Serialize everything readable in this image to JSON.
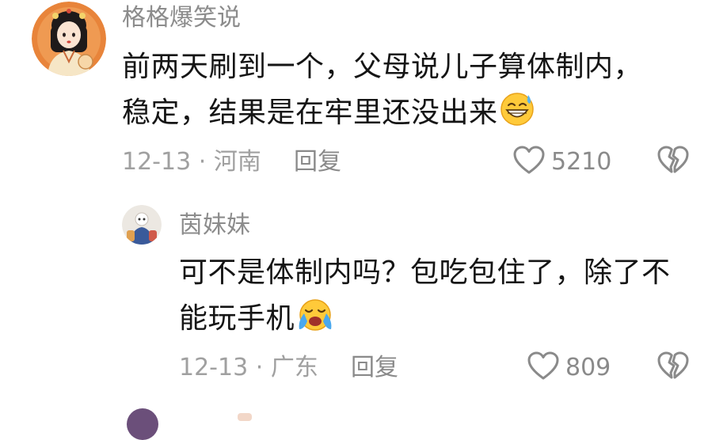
{
  "comments": [
    {
      "username": "格格爆笑说",
      "content_lines": [
        "前两天刷到一个，父母说儿子算体制内，",
        "稳定，结果是在牢里还没出来"
      ],
      "emoji": "grinning-sweat-emoji",
      "date": "12-13",
      "separator": "·",
      "location": "河南",
      "reply_label": "回复",
      "like_count": "5210"
    },
    {
      "username": "茵妹妹",
      "content_lines": [
        "可不是体制内吗？包吃包住了，除了不",
        "能玩手机"
      ],
      "emoji": "loudly-crying-emoji",
      "date": "12-13",
      "separator": "·",
      "location": "广东",
      "reply_label": "回复",
      "like_count": "809"
    }
  ],
  "icons": {
    "like": "heart-outline-icon",
    "dislike": "broken-heart-icon"
  },
  "colors": {
    "text": "#151515",
    "username": "#8c8c8c",
    "meta": "#a0a0a0",
    "icon": "#8a8a8a",
    "avatar_bg": "#e8843a"
  }
}
